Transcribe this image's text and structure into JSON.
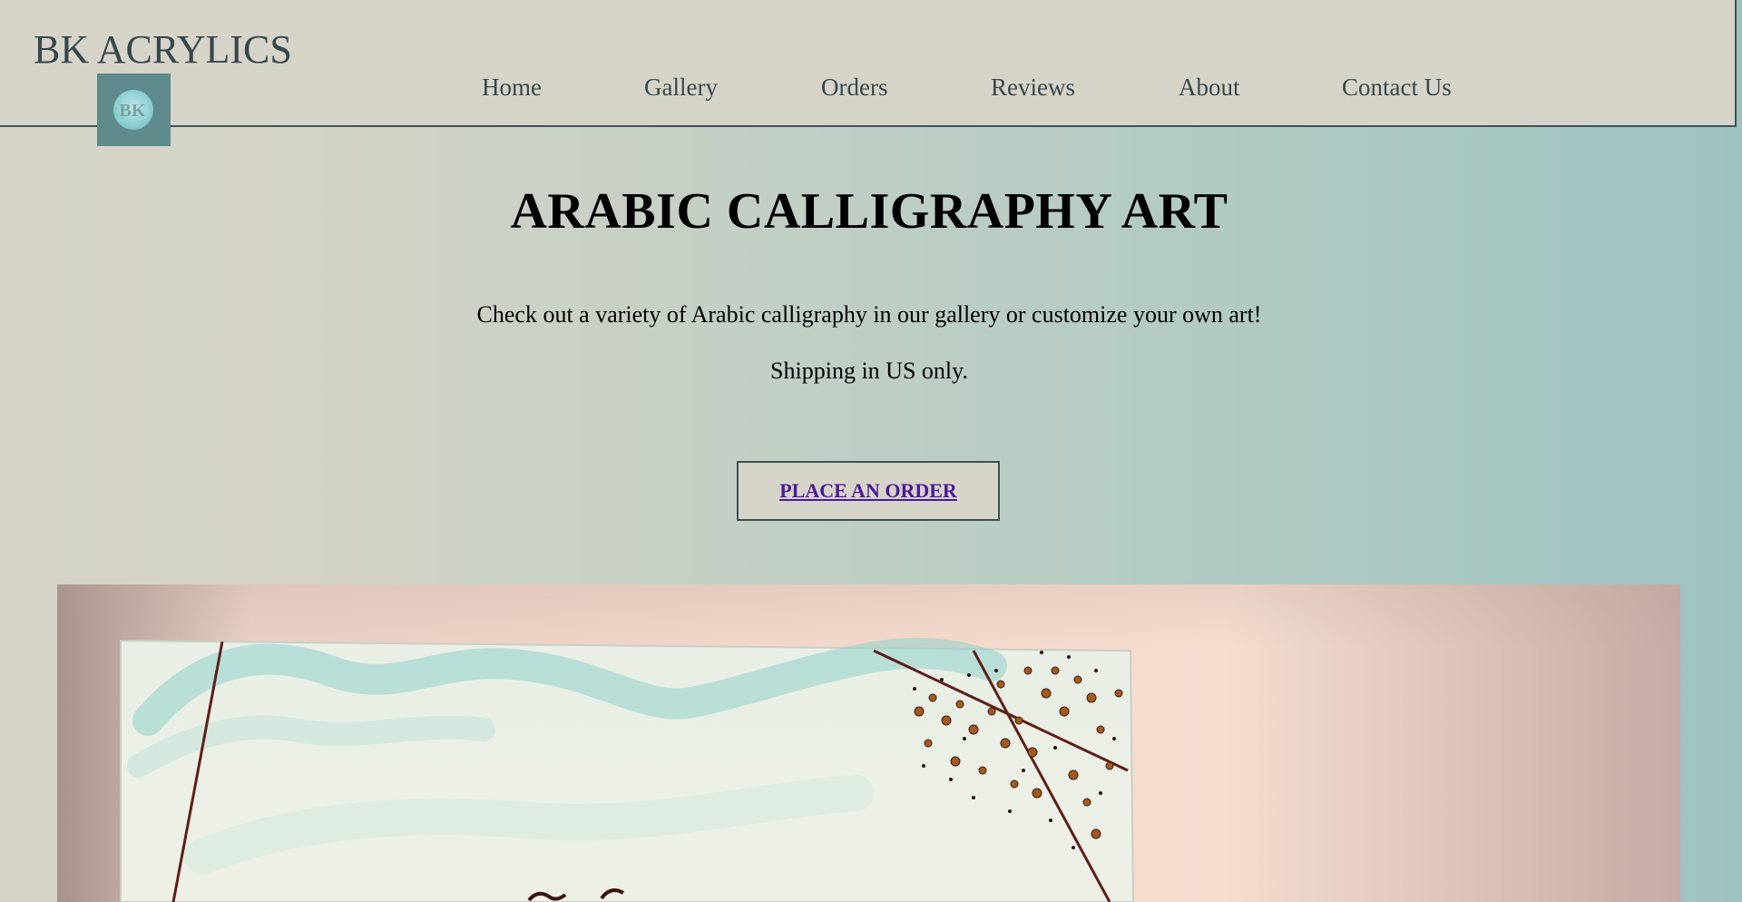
{
  "header": {
    "brand": "BK ACRYLICS",
    "logo_text": "BK",
    "nav": [
      {
        "label": "Home"
      },
      {
        "label": "Gallery"
      },
      {
        "label": "Orders"
      },
      {
        "label": "Reviews"
      },
      {
        "label": "About"
      },
      {
        "label": "Contact Us"
      }
    ]
  },
  "hero": {
    "title": "ARABIC CALLIGRAPHY ART",
    "subtitle": "Check out a variety of Arabic calligraphy in our gallery or customize your own art!",
    "shipping": "Shipping in US only.",
    "cta_label": "PLACE AN ORDER"
  },
  "colors": {
    "header_bg": "#d6d4c8",
    "border": "#3d5258",
    "text_dark": "#37484d",
    "link": "#4b1a9c",
    "logo_bg": "#5f8a8c"
  }
}
